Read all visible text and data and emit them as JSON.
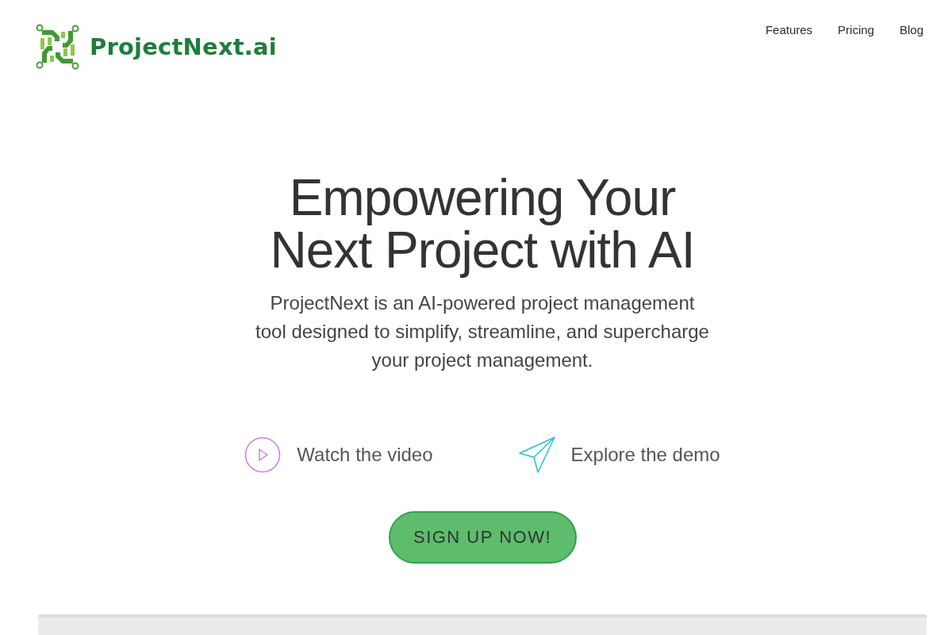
{
  "header": {
    "brand": "ProjectNext.ai",
    "nav": [
      "Features",
      "Pricing",
      "Blog"
    ]
  },
  "hero": {
    "title_lines": [
      "Empowering Your",
      "Next Project with AI"
    ],
    "subtitle_lines": [
      "ProjectNext is an AI-powered project management",
      "tool designed to simplify, streamline, and supercharge",
      "your project management."
    ],
    "actions": [
      {
        "kind": "video",
        "label": "Watch the video"
      },
      {
        "kind": "demo",
        "label": "Explore the demo"
      }
    ],
    "cta": "SIGN UP NOW!"
  }
}
